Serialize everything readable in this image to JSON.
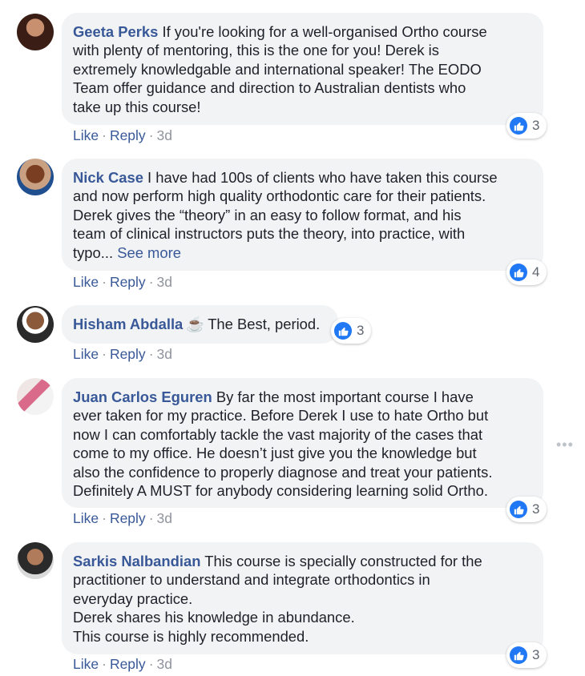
{
  "comments": [
    {
      "name": "Geeta Perks",
      "text_first": " If you're looking for a well-organised Ortho course",
      "lines": [
        "with plenty of mentoring, this is the one for you! Derek is",
        "extremely knowledgable and international speaker! The EODO",
        "Team offer guidance and direction to Australian dentists who",
        "take up this course!"
      ],
      "like": "Like",
      "reply": "Reply",
      "time": "3d",
      "reactions": "3"
    },
    {
      "name": "Nick Case",
      "text_first": " I have had 100s of clients who have taken this course",
      "lines": [
        "and now perform high quality orthodontic care for their patients.",
        "Derek gives the “theory” in an easy to follow format, and his",
        "team of clinical instructors puts the theory, into practice, with"
      ],
      "last_line": "typo...",
      "see_more": "See more",
      "like": "Like",
      "reply": "Reply",
      "time": "3d",
      "reactions": "4"
    },
    {
      "name": "Hisham Abdalla",
      "emoji": "☕",
      "text_first": "The Best, period.",
      "like": "Like",
      "reply": "Reply",
      "time": "3d",
      "reactions": "3"
    },
    {
      "name": "Juan Carlos Eguren",
      "text_first": " By far the most important course I have",
      "lines": [
        "ever taken for my practice. Before Derek I use to hate Ortho but",
        "now I can comfortably tackle the vast majority of the cases that",
        "come to my office. He doesn’t just give you the knowledge but",
        "also the confidence to properly diagnose and treat your patients.",
        "Definitely A MUST for anybody considering learning solid Ortho."
      ],
      "like": "Like",
      "reply": "Reply",
      "time": "3d",
      "reactions": "3"
    },
    {
      "name": "Sarkis Nalbandian",
      "text_first": " This course is specially constructed for the",
      "lines": [
        "practitioner to understand and integrate orthodontics in",
        "everyday practice.",
        "Derek shares his knowledge in abundance.",
        "This course is highly recommended."
      ],
      "like": "Like",
      "reply": "Reply",
      "time": "3d",
      "reactions": "3"
    }
  ],
  "separator": "·",
  "icons": {
    "avatar": "avatar-icon",
    "reaction": "like-reaction-icon",
    "more": "more-options-icon"
  },
  "colors": {
    "link": "#385898",
    "bubble": "#f2f3f5",
    "like_blue": "#2078f4"
  }
}
